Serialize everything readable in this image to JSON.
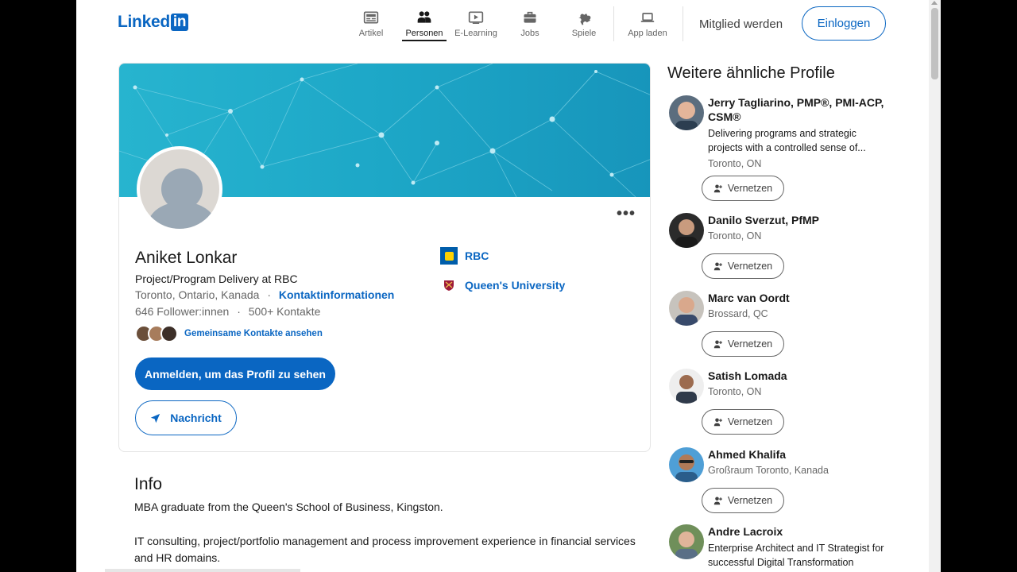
{
  "header": {
    "logo_text": "Linked",
    "logo_in": "in",
    "nav": [
      {
        "label": "Artikel",
        "icon": "article-icon"
      },
      {
        "label": "Personen",
        "icon": "people-icon",
        "active": true
      },
      {
        "label": "E-Learning",
        "icon": "learning-icon"
      },
      {
        "label": "Jobs",
        "icon": "briefcase-icon"
      },
      {
        "label": "Spiele",
        "icon": "puzzle-icon"
      },
      {
        "label": "App laden",
        "icon": "laptop-icon"
      }
    ],
    "join_label": "Mitglied werden",
    "signin_label": "Einloggen"
  },
  "profile": {
    "more_label": "•••",
    "name": "Aniket Lonkar",
    "headline": "Project/Program Delivery at RBC",
    "location": "Toronto, Ontario, Kanada",
    "separator": "·",
    "contact_info": "Kontaktinformationen",
    "followers": "646 Follower:innen",
    "connections": "500+ Kontakte",
    "mutual_label": "Gemeinsame Kontakte ansehen",
    "signin_cta": "Anmelden, um das Profil zu sehen",
    "message_label": "Nachricht",
    "experience": [
      {
        "label": "RBC",
        "icon": "rbc-logo-icon"
      },
      {
        "label": "Queen's University",
        "icon": "queens-crest-icon"
      }
    ]
  },
  "about": {
    "title": "Info",
    "para1": "MBA graduate from the Queen's School of Business, Kingston.",
    "para2": "IT consulting, project/portfolio management and process improvement experience in financial services and HR domains."
  },
  "sidebar": {
    "title": "Weitere ähnliche Profile",
    "connect_label": "Vernetzen",
    "people": [
      {
        "name": "Jerry Tagliarino, PMP®, PMI-ACP, CSM®",
        "desc": "Delivering programs and strategic projects with a controlled sense of...",
        "location": "Toronto, ON"
      },
      {
        "name": "Danilo Sverzut, PfMP",
        "desc": "",
        "location": "Toronto, ON"
      },
      {
        "name": "Marc van Oordt",
        "desc": "",
        "location": "Brossard, QC"
      },
      {
        "name": "Satish Lomada",
        "desc": "",
        "location": "Toronto, ON"
      },
      {
        "name": "Ahmed Khalifa",
        "desc": "",
        "location": "Großraum Toronto, Kanada"
      },
      {
        "name": "Andre Lacroix",
        "desc": "Enterprise Architect and IT Strategist for successful Digital Transformation",
        "location": ""
      }
    ]
  },
  "colors": {
    "brand": "#0a66c2",
    "banner": "#1da7c7"
  }
}
